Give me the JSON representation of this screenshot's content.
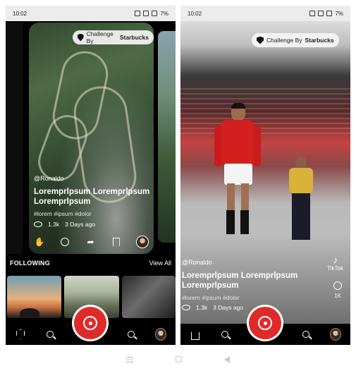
{
  "left": {
    "status": {
      "time": "10:02",
      "battery": "7%"
    },
    "challenge": {
      "prefix": "Challenge By",
      "brand": "Starbucks"
    },
    "post": {
      "handle": "@Ronaldo",
      "title": "Loremprlpsum Loremprlpsum Loremprlpsum",
      "title_line1": "Loremprlpsum Loremprlpsum",
      "title_line1_display": "Loremprlpsum Loremprlpsum",
      "tags": "#lorem #ipsum #dolor",
      "views": "1.3k",
      "age": "3 Days ago"
    },
    "following": {
      "label": "FOLLOWING",
      "view_all": "View All"
    }
  },
  "right": {
    "status": {
      "time": "10:02",
      "battery": "7%"
    },
    "challenge": {
      "prefix": "Challenge By",
      "brand": "Starbucks"
    },
    "post": {
      "handle": "@Ronaldo",
      "title_line1": "Loremprlpsum Loremprlpsum",
      "title_line2": "Loremprlpsum",
      "tags": "#lorem #ipsum #dolor",
      "views": "1.3k",
      "age": "3 Days ago"
    },
    "tiktok": {
      "label": "TikTok"
    },
    "comments": {
      "count": "1K"
    }
  },
  "texts": {
    "left_title_l1": "Loremprlpsum Loremprlpsum",
    "left_title_l2": "Loremprlpsum",
    "right_title_l1": "Loremprlpsum Loremprlpsum",
    "right_title_l2": "Loremprlpsum"
  },
  "colors": {
    "accent": "#e02a2a",
    "background": "#000000"
  }
}
